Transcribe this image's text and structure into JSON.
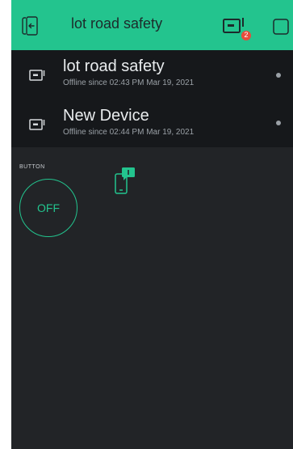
{
  "header": {
    "title": "lot road safety",
    "notification_count": "2",
    "back_icon": "exit-icon",
    "devices_icon": "device-icon",
    "square_icon": "square-icon"
  },
  "devices": [
    {
      "name": "lot road safety",
      "status": "Offline since 02:43 PM Mar 19, 2021"
    },
    {
      "name": "New Device",
      "status": "Offline since 02:44 PM Mar 19, 2021"
    }
  ],
  "widget": {
    "label": "BUTTON",
    "button_label": "OFF"
  },
  "colors": {
    "accent": "#23c48e",
    "background": "#222427",
    "list_background": "#16181b",
    "badge": "#e74c3c"
  }
}
